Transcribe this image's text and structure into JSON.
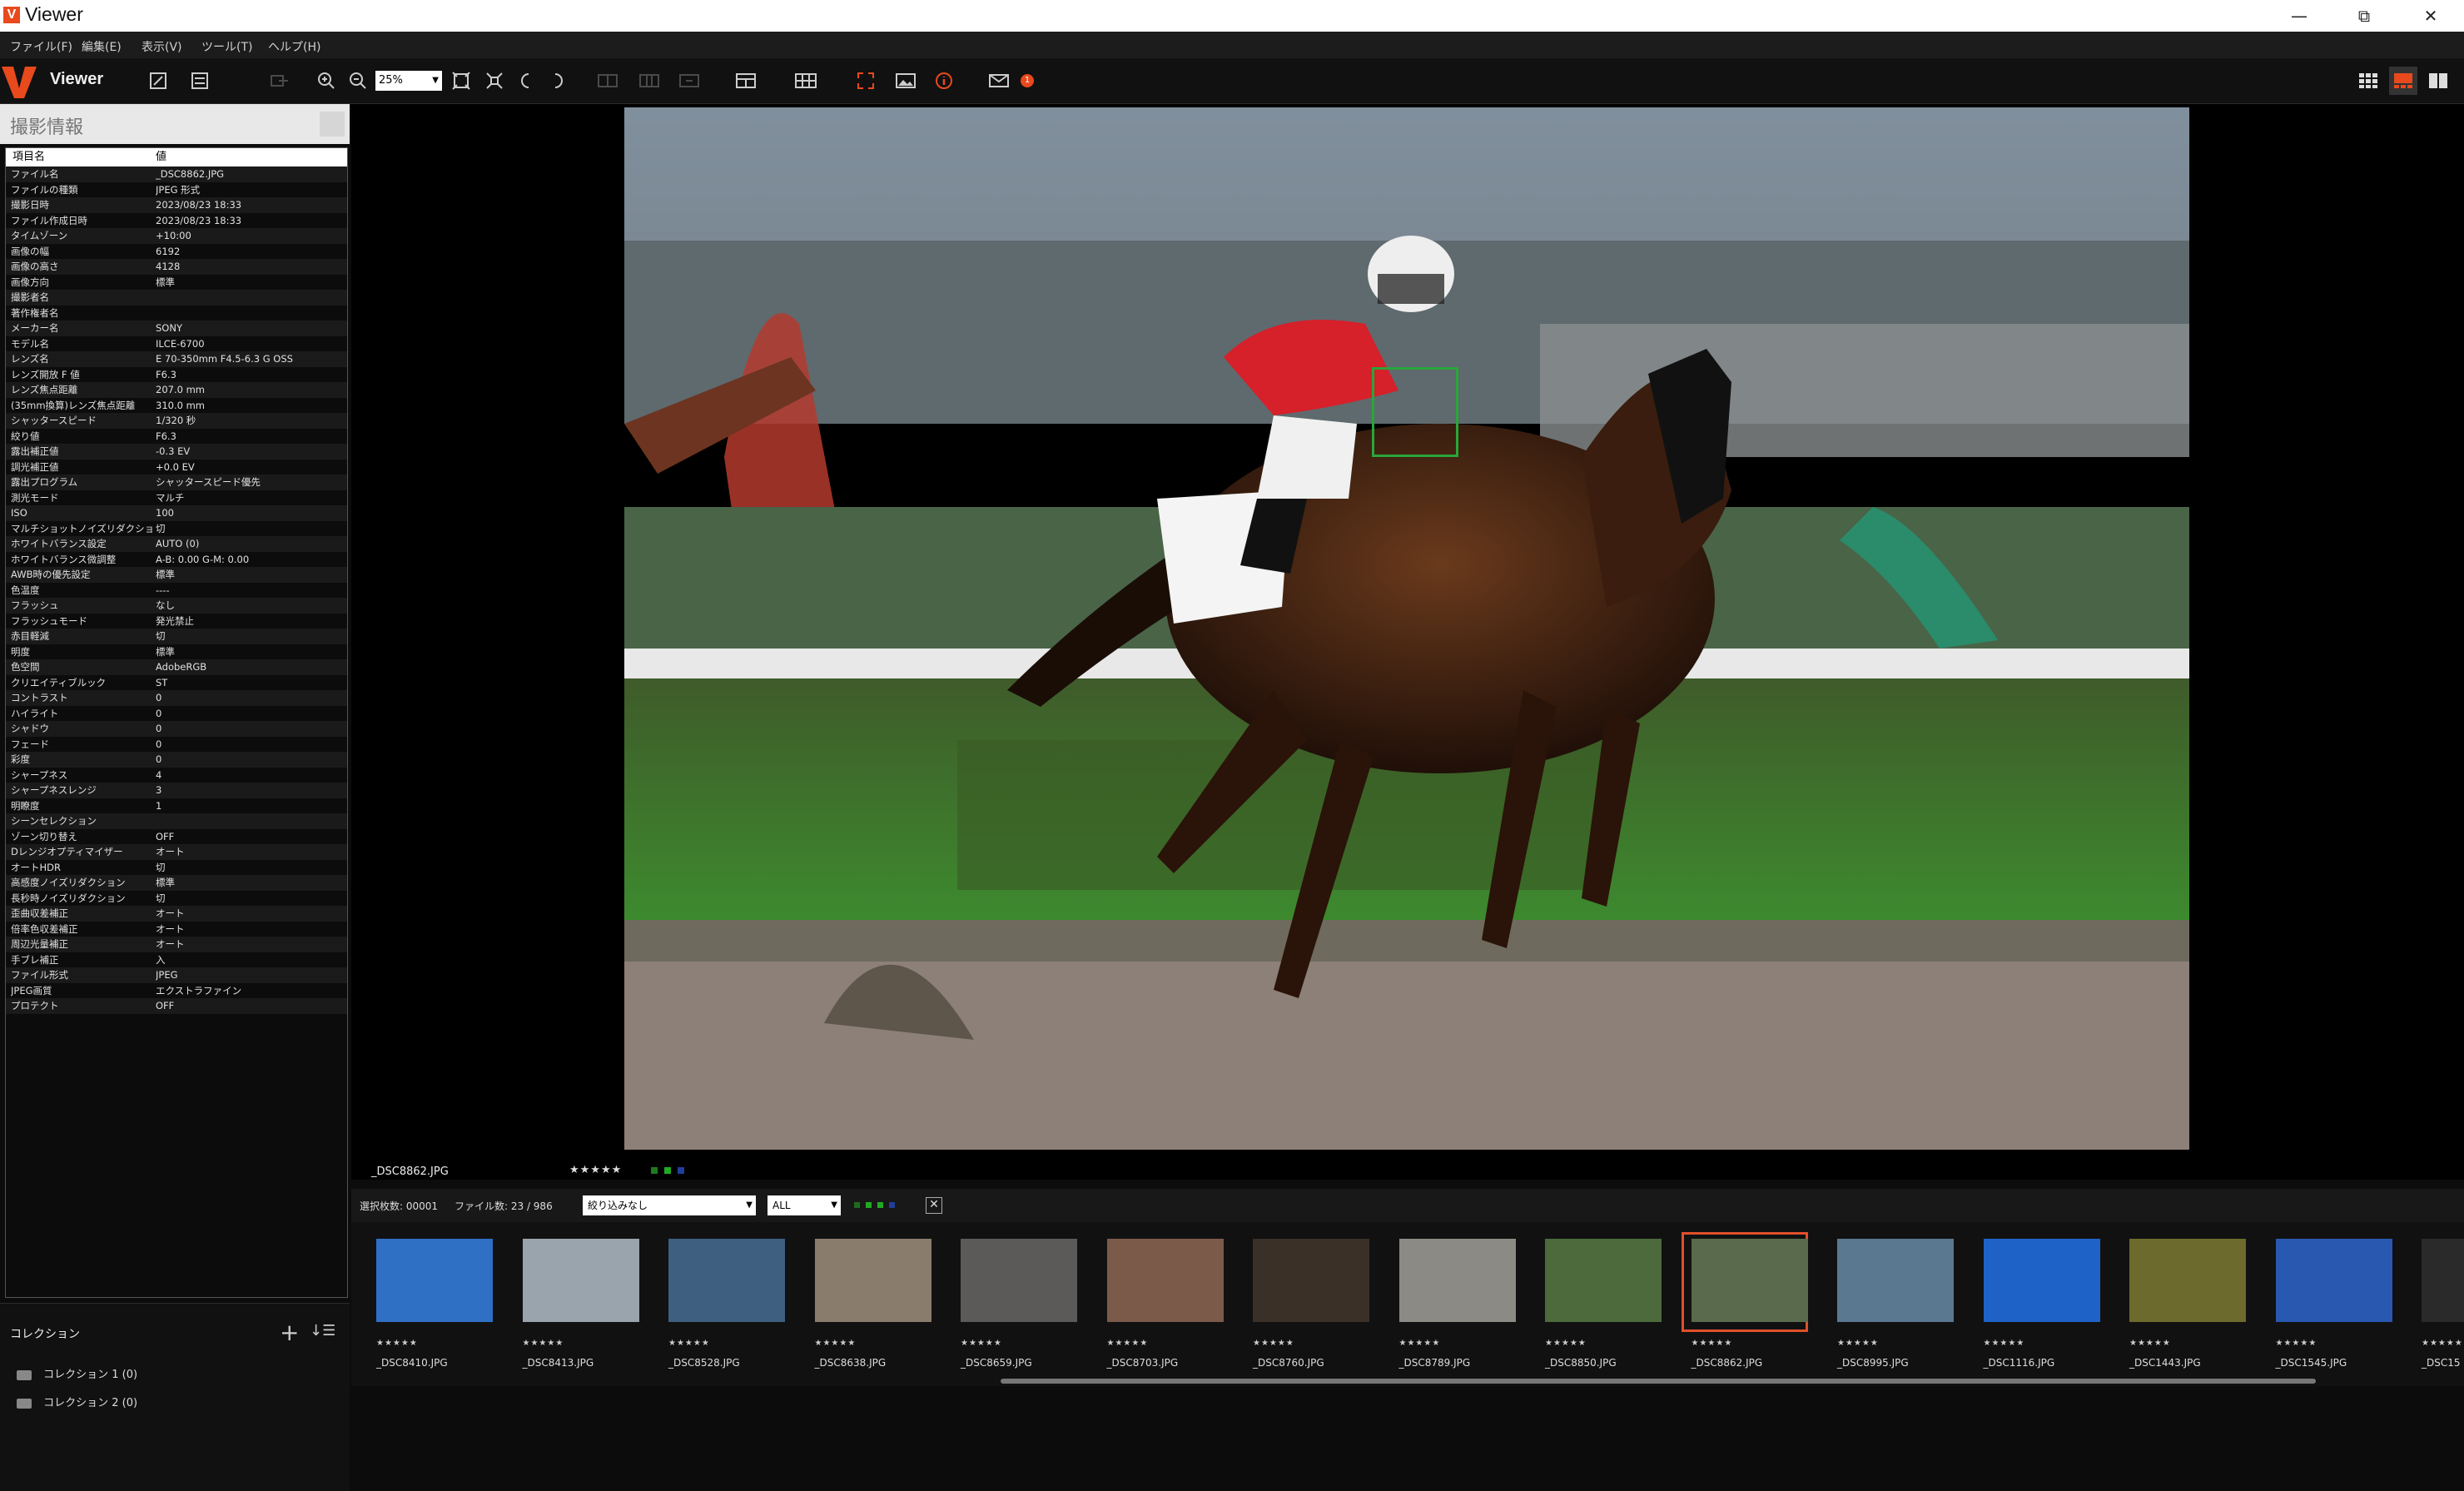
{
  "window": {
    "title": "Viewer",
    "logo": "V",
    "minimize": "—",
    "maximize": "⧉",
    "close": "✕"
  },
  "menu": [
    "ファイル(F)",
    "編集(E)",
    "表示(V)",
    "ツール(T)",
    "ヘルプ(H)"
  ],
  "toolbar": {
    "app_name": "Viewer",
    "zoom": "25%",
    "alert_count": "1"
  },
  "info_panel": {
    "title": "撮影情報",
    "col_key": "項目名",
    "col_value": "値",
    "rows": [
      {
        "k": "ファイル名",
        "v": "_DSC8862.JPG"
      },
      {
        "k": "ファイルの種類",
        "v": "JPEG 形式"
      },
      {
        "k": "撮影日時",
        "v": "2023/08/23 18:33"
      },
      {
        "k": "ファイル作成日時",
        "v": "2023/08/23 18:33"
      },
      {
        "k": "タイムゾーン",
        "v": "+10:00"
      },
      {
        "k": "画像の幅",
        "v": "6192"
      },
      {
        "k": "画像の高さ",
        "v": "4128"
      },
      {
        "k": "画像方向",
        "v": "標準"
      },
      {
        "k": "撮影者名",
        "v": ""
      },
      {
        "k": "著作権者名",
        "v": ""
      },
      {
        "k": "メーカー名",
        "v": "SONY"
      },
      {
        "k": "モデル名",
        "v": "ILCE-6700"
      },
      {
        "k": "レンズ名",
        "v": "E 70-350mm F4.5-6.3 G OSS"
      },
      {
        "k": "レンズ開放 F 値",
        "v": "F6.3"
      },
      {
        "k": "レンズ焦点距離",
        "v": "207.0 mm"
      },
      {
        "k": "(35mm換算)レンズ焦点距離",
        "v": "310.0 mm"
      },
      {
        "k": "シャッタースピード",
        "v": "1/320 秒"
      },
      {
        "k": "絞り値",
        "v": "F6.3"
      },
      {
        "k": "露出補正値",
        "v": "-0.3 EV"
      },
      {
        "k": "調光補正値",
        "v": "+0.0 EV"
      },
      {
        "k": "露出プログラム",
        "v": "シャッタースピード優先"
      },
      {
        "k": "測光モード",
        "v": "マルチ"
      },
      {
        "k": "ISO",
        "v": "100"
      },
      {
        "k": "マルチショットノイズリダクション",
        "v": "切"
      },
      {
        "k": "ホワイトバランス設定",
        "v": "AUTO (0)"
      },
      {
        "k": "ホワイトバランス微調整",
        "v": "A-B: 0.00 G-M: 0.00"
      },
      {
        "k": "AWB時の優先設定",
        "v": "標準"
      },
      {
        "k": "色温度",
        "v": "----"
      },
      {
        "k": "フラッシュ",
        "v": "なし"
      },
      {
        "k": "フラッシュモード",
        "v": "発光禁止"
      },
      {
        "k": "赤目軽減",
        "v": "切"
      },
      {
        "k": "明度",
        "v": "標準"
      },
      {
        "k": "色空間",
        "v": "AdobeRGB"
      },
      {
        "k": "クリエイティブルック",
        "v": "ST"
      },
      {
        "k": "コントラスト",
        "v": "0"
      },
      {
        "k": "ハイライト",
        "v": "0"
      },
      {
        "k": "シャドウ",
        "v": "0"
      },
      {
        "k": "フェード",
        "v": "0"
      },
      {
        "k": "彩度",
        "v": "0"
      },
      {
        "k": "シャープネス",
        "v": "4"
      },
      {
        "k": "シャープネスレンジ",
        "v": "3"
      },
      {
        "k": "明瞭度",
        "v": "1"
      },
      {
        "k": "シーンセレクション",
        "v": ""
      },
      {
        "k": "ゾーン切り替え",
        "v": "OFF"
      },
      {
        "k": "Dレンジオプティマイザー",
        "v": "オート"
      },
      {
        "k": "オートHDR",
        "v": "切"
      },
      {
        "k": "高感度ノイズリダクション",
        "v": "標準"
      },
      {
        "k": "長秒時ノイズリダクション",
        "v": "切"
      },
      {
        "k": "歪曲収差補正",
        "v": "オート"
      },
      {
        "k": "倍率色収差補正",
        "v": "オート"
      },
      {
        "k": "周辺光量補正",
        "v": "オート"
      },
      {
        "k": "手ブレ補正",
        "v": "入"
      },
      {
        "k": "ファイル形式",
        "v": "JPEG"
      },
      {
        "k": "JPEG画質",
        "v": "エクストラファイン"
      },
      {
        "k": "プロテクト",
        "v": "OFF"
      }
    ]
  },
  "collection": {
    "title": "コレクション",
    "items": [
      "コレクション 1 (0)",
      "コレクション 2 (0)"
    ]
  },
  "viewer": {
    "filename": "_DSC8862.JPG",
    "rating": "★★★★★"
  },
  "filterbar": {
    "selected": "選択枚数: 00001",
    "file_count": "ファイル数: 23 / 986",
    "filter_select": "絞り込みなし",
    "label_select": "ALL"
  },
  "thumbnails": [
    {
      "label": "_DSC8410.JPG",
      "bg": "#2f6fc4",
      "selected": false
    },
    {
      "label": "_DSC8413.JPG",
      "bg": "#9aa4ad",
      "selected": false
    },
    {
      "label": "_DSC8528.JPG",
      "bg": "#3e5f80",
      "selected": false
    },
    {
      "label": "_DSC8638.JPG",
      "bg": "#8a7c6c",
      "selected": false
    },
    {
      "label": "_DSC8659.JPG",
      "bg": "#5c5a58",
      "selected": false
    },
    {
      "label": "_DSC8703.JPG",
      "bg": "#7c5a4a",
      "selected": false
    },
    {
      "label": "_DSC8760.JPG",
      "bg": "#3a3028",
      "selected": false
    },
    {
      "label": "_DSC8789.JPG",
      "bg": "#8c8a84",
      "selected": false
    },
    {
      "label": "_DSC8850.JPG",
      "bg": "#4c6a3c",
      "selected": false
    },
    {
      "label": "_DSC8862.JPG",
      "bg": "#5a6a4c",
      "selected": true
    },
    {
      "label": "_DSC8995.JPG",
      "bg": "#5a7890",
      "selected": false
    },
    {
      "label": "_DSC1116.JPG",
      "bg": "#1e62c8",
      "selected": false
    },
    {
      "label": "_DSC1443.JPG",
      "bg": "#6c6a2c",
      "selected": false
    },
    {
      "label": "_DSC1545.JPG",
      "bg": "#2858b0",
      "selected": false
    },
    {
      "label": "_DSC15",
      "bg": "#2a2a2a",
      "selected": false
    }
  ],
  "colors": {
    "accent": "#e8491d",
    "focus_box": "#2aa53a",
    "selected_thumb": "#e0502a"
  },
  "icons": [
    "minimize-icon",
    "restore-icon",
    "close-icon",
    "zoom-in-icon",
    "zoom-out-icon",
    "fit-icon",
    "rotate-left-icon",
    "rotate-right-icon",
    "grid-view-icon",
    "viewer-icon",
    "compare-icon",
    "mail-icon",
    "info-icon"
  ]
}
